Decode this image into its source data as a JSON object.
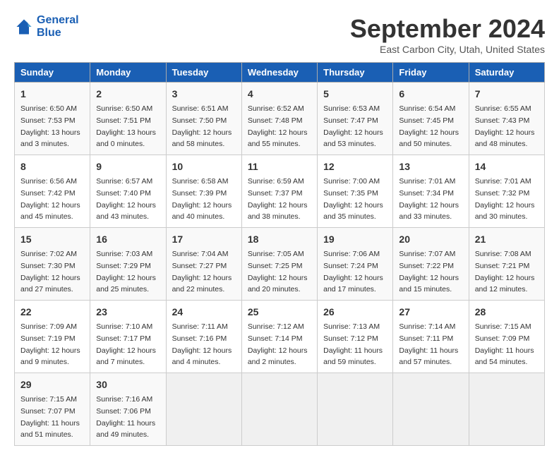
{
  "header": {
    "logo_text_1": "General",
    "logo_text_2": "Blue",
    "month_title": "September 2024",
    "subtitle": "East Carbon City, Utah, United States"
  },
  "days_of_week": [
    "Sunday",
    "Monday",
    "Tuesday",
    "Wednesday",
    "Thursday",
    "Friday",
    "Saturday"
  ],
  "weeks": [
    [
      {
        "day": "1",
        "sunrise": "Sunrise: 6:50 AM",
        "sunset": "Sunset: 7:53 PM",
        "daylight": "Daylight: 13 hours and 3 minutes."
      },
      {
        "day": "2",
        "sunrise": "Sunrise: 6:50 AM",
        "sunset": "Sunset: 7:51 PM",
        "daylight": "Daylight: 13 hours and 0 minutes."
      },
      {
        "day": "3",
        "sunrise": "Sunrise: 6:51 AM",
        "sunset": "Sunset: 7:50 PM",
        "daylight": "Daylight: 12 hours and 58 minutes."
      },
      {
        "day": "4",
        "sunrise": "Sunrise: 6:52 AM",
        "sunset": "Sunset: 7:48 PM",
        "daylight": "Daylight: 12 hours and 55 minutes."
      },
      {
        "day": "5",
        "sunrise": "Sunrise: 6:53 AM",
        "sunset": "Sunset: 7:47 PM",
        "daylight": "Daylight: 12 hours and 53 minutes."
      },
      {
        "day": "6",
        "sunrise": "Sunrise: 6:54 AM",
        "sunset": "Sunset: 7:45 PM",
        "daylight": "Daylight: 12 hours and 50 minutes."
      },
      {
        "day": "7",
        "sunrise": "Sunrise: 6:55 AM",
        "sunset": "Sunset: 7:43 PM",
        "daylight": "Daylight: 12 hours and 48 minutes."
      }
    ],
    [
      {
        "day": "8",
        "sunrise": "Sunrise: 6:56 AM",
        "sunset": "Sunset: 7:42 PM",
        "daylight": "Daylight: 12 hours and 45 minutes."
      },
      {
        "day": "9",
        "sunrise": "Sunrise: 6:57 AM",
        "sunset": "Sunset: 7:40 PM",
        "daylight": "Daylight: 12 hours and 43 minutes."
      },
      {
        "day": "10",
        "sunrise": "Sunrise: 6:58 AM",
        "sunset": "Sunset: 7:39 PM",
        "daylight": "Daylight: 12 hours and 40 minutes."
      },
      {
        "day": "11",
        "sunrise": "Sunrise: 6:59 AM",
        "sunset": "Sunset: 7:37 PM",
        "daylight": "Daylight: 12 hours and 38 minutes."
      },
      {
        "day": "12",
        "sunrise": "Sunrise: 7:00 AM",
        "sunset": "Sunset: 7:35 PM",
        "daylight": "Daylight: 12 hours and 35 minutes."
      },
      {
        "day": "13",
        "sunrise": "Sunrise: 7:01 AM",
        "sunset": "Sunset: 7:34 PM",
        "daylight": "Daylight: 12 hours and 33 minutes."
      },
      {
        "day": "14",
        "sunrise": "Sunrise: 7:01 AM",
        "sunset": "Sunset: 7:32 PM",
        "daylight": "Daylight: 12 hours and 30 minutes."
      }
    ],
    [
      {
        "day": "15",
        "sunrise": "Sunrise: 7:02 AM",
        "sunset": "Sunset: 7:30 PM",
        "daylight": "Daylight: 12 hours and 27 minutes."
      },
      {
        "day": "16",
        "sunrise": "Sunrise: 7:03 AM",
        "sunset": "Sunset: 7:29 PM",
        "daylight": "Daylight: 12 hours and 25 minutes."
      },
      {
        "day": "17",
        "sunrise": "Sunrise: 7:04 AM",
        "sunset": "Sunset: 7:27 PM",
        "daylight": "Daylight: 12 hours and 22 minutes."
      },
      {
        "day": "18",
        "sunrise": "Sunrise: 7:05 AM",
        "sunset": "Sunset: 7:25 PM",
        "daylight": "Daylight: 12 hours and 20 minutes."
      },
      {
        "day": "19",
        "sunrise": "Sunrise: 7:06 AM",
        "sunset": "Sunset: 7:24 PM",
        "daylight": "Daylight: 12 hours and 17 minutes."
      },
      {
        "day": "20",
        "sunrise": "Sunrise: 7:07 AM",
        "sunset": "Sunset: 7:22 PM",
        "daylight": "Daylight: 12 hours and 15 minutes."
      },
      {
        "day": "21",
        "sunrise": "Sunrise: 7:08 AM",
        "sunset": "Sunset: 7:21 PM",
        "daylight": "Daylight: 12 hours and 12 minutes."
      }
    ],
    [
      {
        "day": "22",
        "sunrise": "Sunrise: 7:09 AM",
        "sunset": "Sunset: 7:19 PM",
        "daylight": "Daylight: 12 hours and 9 minutes."
      },
      {
        "day": "23",
        "sunrise": "Sunrise: 7:10 AM",
        "sunset": "Sunset: 7:17 PM",
        "daylight": "Daylight: 12 hours and 7 minutes."
      },
      {
        "day": "24",
        "sunrise": "Sunrise: 7:11 AM",
        "sunset": "Sunset: 7:16 PM",
        "daylight": "Daylight: 12 hours and 4 minutes."
      },
      {
        "day": "25",
        "sunrise": "Sunrise: 7:12 AM",
        "sunset": "Sunset: 7:14 PM",
        "daylight": "Daylight: 12 hours and 2 minutes."
      },
      {
        "day": "26",
        "sunrise": "Sunrise: 7:13 AM",
        "sunset": "Sunset: 7:12 PM",
        "daylight": "Daylight: 11 hours and 59 minutes."
      },
      {
        "day": "27",
        "sunrise": "Sunrise: 7:14 AM",
        "sunset": "Sunset: 7:11 PM",
        "daylight": "Daylight: 11 hours and 57 minutes."
      },
      {
        "day": "28",
        "sunrise": "Sunrise: 7:15 AM",
        "sunset": "Sunset: 7:09 PM",
        "daylight": "Daylight: 11 hours and 54 minutes."
      }
    ],
    [
      {
        "day": "29",
        "sunrise": "Sunrise: 7:15 AM",
        "sunset": "Sunset: 7:07 PM",
        "daylight": "Daylight: 11 hours and 51 minutes."
      },
      {
        "day": "30",
        "sunrise": "Sunrise: 7:16 AM",
        "sunset": "Sunset: 7:06 PM",
        "daylight": "Daylight: 11 hours and 49 minutes."
      },
      null,
      null,
      null,
      null,
      null
    ]
  ]
}
